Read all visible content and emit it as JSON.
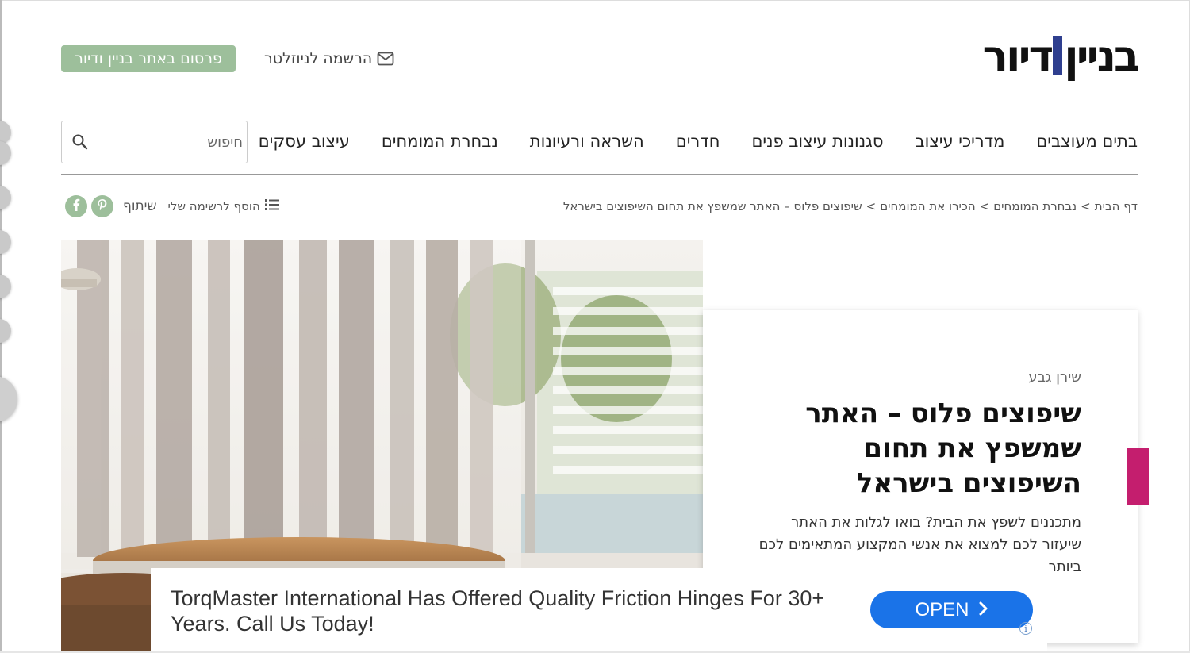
{
  "site": {
    "logo_left": "בניין",
    "logo_right": "דיור"
  },
  "header": {
    "newsletter_label": "הרשמה לניוזלטר",
    "advertise_label": "פרסום באתר בניין ודיור"
  },
  "nav": {
    "items": [
      {
        "label": "בתים מעוצבים"
      },
      {
        "label": "מדריכי עיצוב"
      },
      {
        "label": "סגנונות עיצוב פנים"
      },
      {
        "label": "חדרים"
      },
      {
        "label": "השראה ורעיונות"
      },
      {
        "label": "נבחרת המומחים"
      },
      {
        "label": "עיצוב עסקים"
      }
    ],
    "search_placeholder": "חיפוש"
  },
  "breadcrumb": {
    "home": "דף הבית",
    "level1": "נבחרת המומחים",
    "level2": "הכירו את המומחים",
    "current": "שיפוצים פלוס – האתר שמשפץ את תחום השיפוצים בישראל",
    "separator": ">"
  },
  "tools": {
    "add_to_list": "הוסף לרשימה שלי",
    "share": "שיתוף"
  },
  "article": {
    "author": "שירן גבע",
    "title": "שיפוצים פלוס – האתר שמשפץ את תחום השיפוצים בישראל",
    "excerpt": "מתכננים לשפץ את הבית? בואו לגלות את האתר שיעזור לכם למצוא את אנשי המקצוע המתאימים לכם ביותר"
  },
  "ad": {
    "text": "TorqMaster International Has Offered Quality Friction Hinges For 30+ Years. Call Us Today!",
    "button": "OPEN",
    "choice_icon": "i"
  },
  "colors": {
    "accent_green": "#9dbf9b",
    "logo_blue": "#2f3f8f",
    "pink_tab": "#c41e6e",
    "ad_button": "#1a73e8"
  }
}
